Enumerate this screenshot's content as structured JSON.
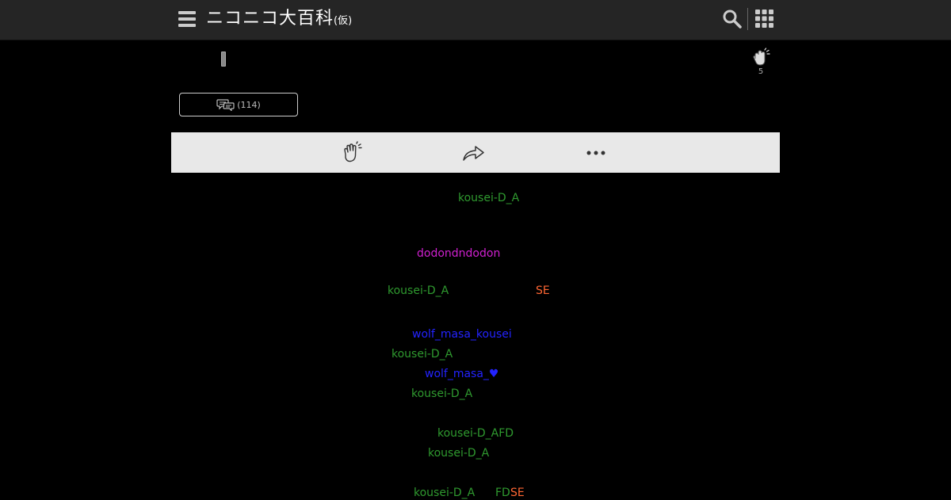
{
  "header": {
    "logo_main": "ニコニコ大百科",
    "logo_sub": "(仮)"
  },
  "reactions": {
    "clap_count": "5"
  },
  "comments": {
    "count_label": "(114)"
  },
  "content_lines": [
    {
      "text": "kousei-D_A",
      "color": "#2f9a2f"
    },
    {
      "text": "dodondndodon",
      "color": "#d020d0"
    },
    {
      "text": "kousei-D_A",
      "color": "#2f9a2f"
    },
    {
      "text": "SE",
      "color": "#ff6633"
    },
    {
      "text": "wolf_masa_kousei",
      "color": "#2323ff"
    },
    {
      "text": "kousei-D_A",
      "color": "#2f9a2f"
    },
    {
      "text": "wolf_masa_♥",
      "color": "#2323ff"
    },
    {
      "text": "kousei-D_A",
      "color": "#2f9a2f"
    },
    {
      "text": "kousei-D_AFD",
      "color": "#2f9a2f"
    },
    {
      "text": "kousei-D_A",
      "color": "#2f9a2f"
    },
    {
      "text": "kousei-D_A",
      "color": "#2f9a2f"
    },
    {
      "text": "FD",
      "color": "#2f9a2f"
    },
    {
      "text": "SE",
      "color": "#ff6633"
    }
  ],
  "colors": {
    "header_bg": "#252525",
    "action_bar_bg": "#e8e8e8",
    "page_bg": "#000000"
  }
}
